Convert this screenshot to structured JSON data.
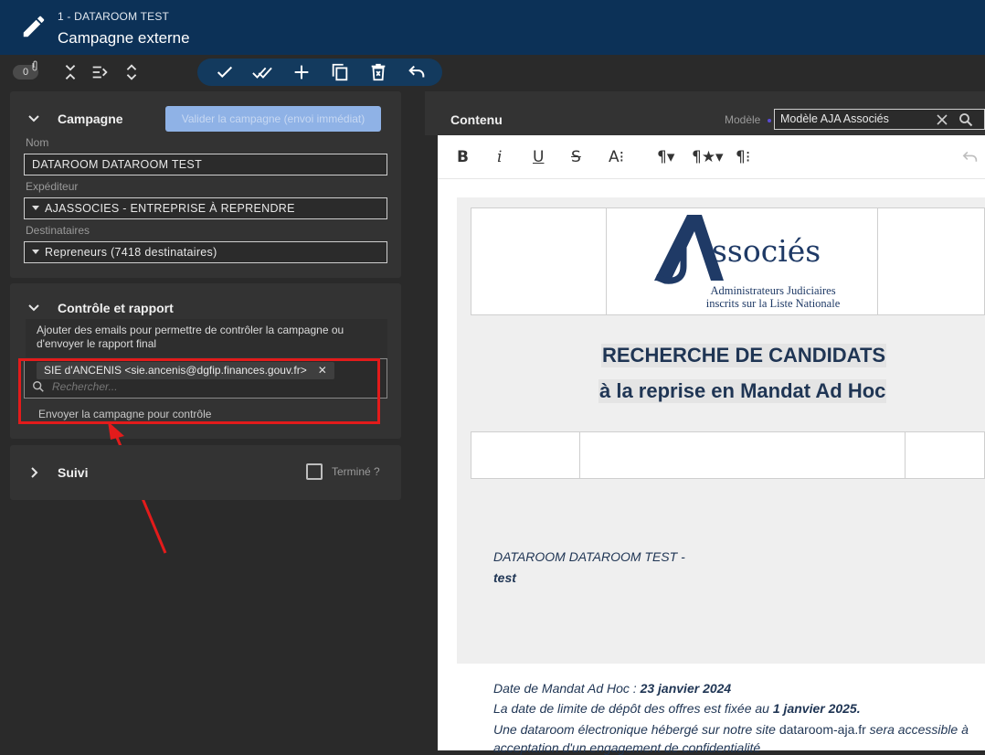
{
  "header": {
    "subtitle": "1 - DATAROOM TEST",
    "title": "Campagne externe"
  },
  "toolbar": {
    "attachment_count": "0"
  },
  "campagne": {
    "section_title": "Campagne",
    "validate_button": "Valider la campagne (envoi immédiat)",
    "nom_label": "Nom",
    "nom_value": "DATAROOM DATAROOM TEST",
    "expediteur_label": "Expéditeur",
    "expediteur_value": "AJASSOCIES - ENTREPRISE À REPRENDRE",
    "destinataires_label": "Destinataires",
    "destinataires_value": "Repreneurs (7418 destinataires)"
  },
  "controle": {
    "section_title": "Contrôle et rapport",
    "hint_line1": "Ajouter des emails pour permettre de contrôler la campagne ou",
    "hint_line2": "d'envoyer le rapport final",
    "chip_label": "SIE d'ANCENIS <sie.ancenis@dgfip.finances.gouv.fr>",
    "search_placeholder": "Rechercher...",
    "send_link": "Envoyer la campagne pour contrôle"
  },
  "suivi": {
    "section_title": "Suivi",
    "termine_label": "Terminé ?"
  },
  "contenu": {
    "title": "Contenu",
    "modele_label": "Modèle",
    "modele_value": "Modèle AJA Associés"
  },
  "document": {
    "logo_brand": "ssociés",
    "logo_line1": "Administrateurs Judiciaires",
    "logo_line2": "inscrits sur la Liste Nationale",
    "heading1": "RECHERCHE DE CANDIDATS",
    "heading2": "à la reprise en Mandat Ad Hoc",
    "line_name": "DATAROOM DATAROOM TEST -",
    "line_test": "test",
    "date_prefix": "Date de Mandat Ad Hoc : ",
    "date_value": "23 janvier 2024",
    "limit_prefix": "La date de limite de dépôt des offres est fixée au ",
    "limit_value": "1 janvier 2025.",
    "dataroom_prefix": "Une dataroom électronique hébergé sur notre site ",
    "dataroom_link": "dataroom-aja.fr",
    "dataroom_suffix": " sera accessible à",
    "engagement": "acceptation d'un engagement de confidentialité"
  },
  "colors": {
    "header_bg": "#0c3157",
    "accent": "#8fb2e6",
    "annotation": "#e31b1b",
    "doc_text": "#1f3554"
  }
}
